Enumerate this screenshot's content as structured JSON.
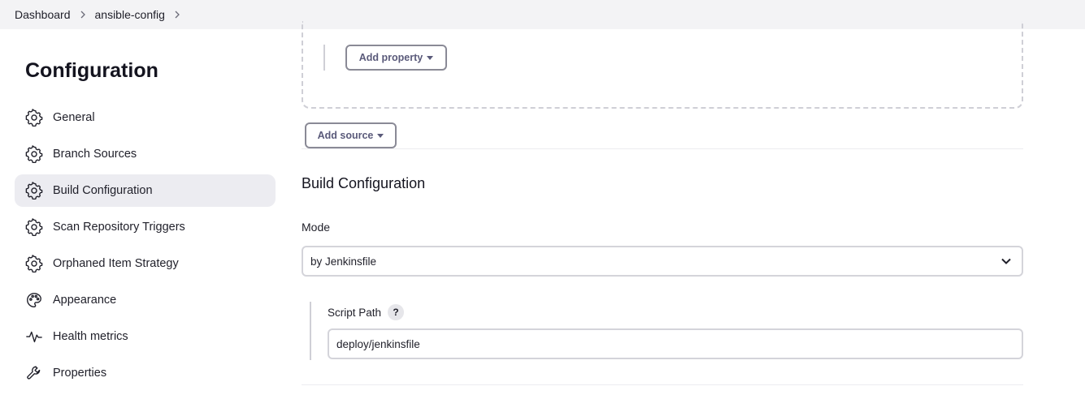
{
  "breadcrumb": {
    "items": [
      "Dashboard",
      "ansible-config"
    ]
  },
  "sidebar": {
    "title": "Configuration",
    "items": [
      {
        "label": "General",
        "icon": "gear-icon",
        "active": false
      },
      {
        "label": "Branch Sources",
        "icon": "gear-icon",
        "active": false
      },
      {
        "label": "Build Configuration",
        "icon": "gear-icon",
        "active": true
      },
      {
        "label": "Scan Repository Triggers",
        "icon": "gear-icon",
        "active": false
      },
      {
        "label": "Orphaned Item Strategy",
        "icon": "gear-icon",
        "active": false
      },
      {
        "label": "Appearance",
        "icon": "palette-icon",
        "active": false
      },
      {
        "label": "Health metrics",
        "icon": "pulse-icon",
        "active": false
      },
      {
        "label": "Properties",
        "icon": "wrench-icon",
        "active": false
      }
    ]
  },
  "main": {
    "add_property_label": "Add property",
    "add_source_label": "Add source",
    "section_title": "Build Configuration",
    "mode_label": "Mode",
    "mode_value": "by Jenkinsfile",
    "script_path_label": "Script Path",
    "script_path_help": "?",
    "script_path_value": "deploy/jenkinsfile"
  }
}
